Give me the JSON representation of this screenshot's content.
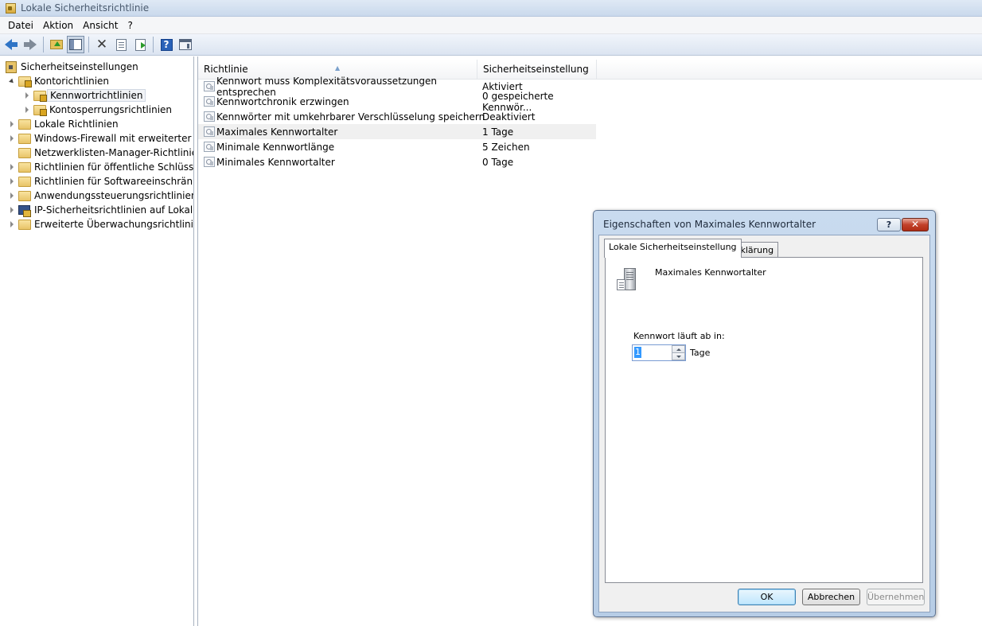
{
  "window": {
    "title": "Lokale Sicherheitsrichtlinie",
    "icon": "security-policy-icon"
  },
  "menu": [
    "Datei",
    "Aktion",
    "Ansicht",
    "?"
  ],
  "toolbar": {
    "buttons": [
      "back-icon",
      "forward-icon",
      "up-folder-icon",
      "show-hide-tree-icon",
      "delete-icon",
      "properties-icon",
      "export-list-icon",
      "help-icon",
      "mmc-console-icon"
    ]
  },
  "tree": {
    "root": "Sicherheitseinstellungen",
    "nodes": [
      {
        "label": "Kontorichtlinien",
        "expanded": true
      },
      {
        "label": "Kennwortrichtlinien",
        "selected": true
      },
      {
        "label": "Kontosperrungsrichtlinien"
      },
      {
        "label": "Lokale Richtlinien"
      },
      {
        "label": "Windows-Firewall mit erweiterter Sicherheit"
      },
      {
        "label": "Netzwerklisten-Manager-Richtlinien"
      },
      {
        "label": "Richtlinien für öffentliche Schlüssel"
      },
      {
        "label": "Richtlinien für Softwareeinschränkung"
      },
      {
        "label": "Anwendungssteuerungsrichtlinien"
      },
      {
        "label": "IP-Sicherheitsrichtlinien auf Lokaler Computer"
      },
      {
        "label": "Erweiterte Überwachungsrichtlinienkonfiguration"
      }
    ]
  },
  "list": {
    "columns": [
      "Richtlinie",
      "Sicherheitseinstellung"
    ],
    "rows": [
      {
        "name": "Kennwort muss Komplexitätsvoraussetzungen entsprechen",
        "value": "Aktiviert"
      },
      {
        "name": "Kennwortchronik erzwingen",
        "value": "0 gespeicherte Kennwör..."
      },
      {
        "name": "Kennwörter mit umkehrbarer Verschlüsselung speichern",
        "value": "Deaktiviert"
      },
      {
        "name": "Maximales Kennwortalter",
        "value": "1 Tage",
        "highlighted": true
      },
      {
        "name": "Minimale Kennwortlänge",
        "value": "5 Zeichen"
      },
      {
        "name": "Minimales Kennwortalter",
        "value": "0 Tage"
      }
    ]
  },
  "dialog": {
    "title": "Eigenschaften von Maximales Kennwortalter",
    "help_label": "?",
    "close_label": "✕",
    "tabs": [
      "Lokale Sicherheitseinstellung",
      "Erklärung"
    ],
    "policy_name": "Maximales Kennwortalter",
    "expire_label": "Kennwort läuft ab in:",
    "expire_value": "1",
    "unit": "Tage",
    "buttons": {
      "ok": "OK",
      "cancel": "Abbrechen",
      "apply": "Übernehmen"
    }
  }
}
